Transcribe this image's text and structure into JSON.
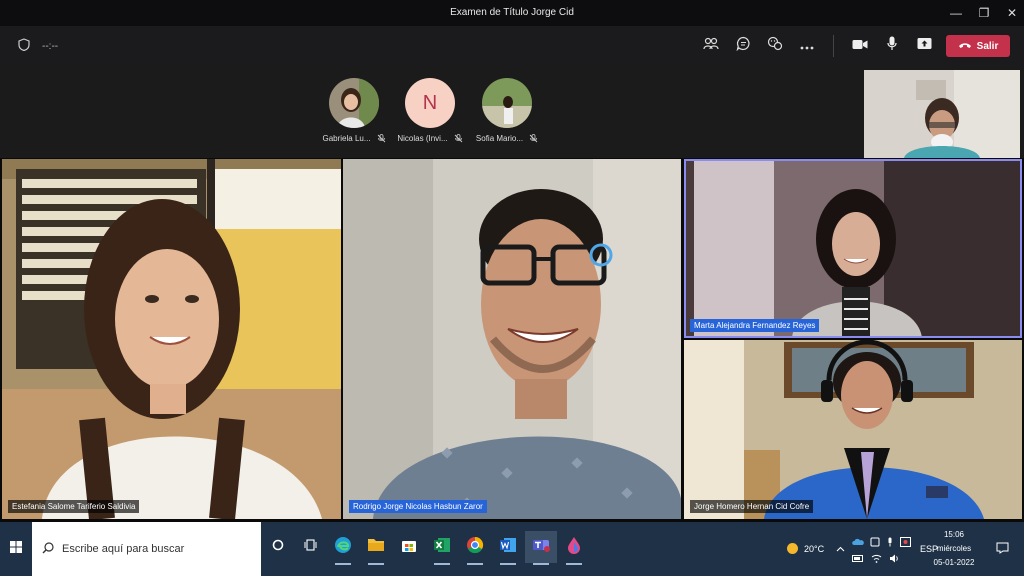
{
  "window": {
    "title": "Examen de Título Jorge Cid",
    "minimize": "—",
    "restore": "❐",
    "close": "✕"
  },
  "toolbar": {
    "timer": "--:--",
    "leave_label": "Salir"
  },
  "attendees": [
    {
      "name": "Gabriela Lu...",
      "initial": ""
    },
    {
      "name": "Nicolas (Invi...",
      "initial": "N"
    },
    {
      "name": "Sofia Mario...",
      "initial": ""
    }
  ],
  "participants": [
    {
      "name": "Estefania Salome Tariferio Saldivia",
      "highlight": false
    },
    {
      "name": "Rodrigo Jorge Nicolas Hasbun Zaror",
      "highlight": true
    },
    {
      "name": "Marta Alejandra Fernandez Reyes",
      "highlight": true
    },
    {
      "name": "Jorge Homero Hernan Cid Cofre",
      "highlight": false
    }
  ],
  "taskbar": {
    "search_placeholder": "Escribe aquí para buscar",
    "weather": "20°C",
    "language": "ESP",
    "time": "15:06",
    "day": "miércoles",
    "date": "05-01-2022"
  },
  "colors": {
    "leave_button": "#c4314b",
    "active_speaker_border": "#8b8cf0",
    "name_highlight": "#2764d8",
    "taskbar": "#1f3147"
  }
}
